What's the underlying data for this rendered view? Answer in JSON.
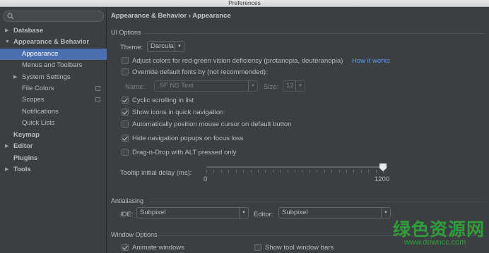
{
  "window": {
    "title": "Preferences"
  },
  "sidebar": {
    "search_placeholder": "",
    "items": [
      {
        "label": "Database",
        "arrow": "▶",
        "bold": true
      },
      {
        "label": "Appearance & Behavior",
        "arrow": "▼",
        "bold": true
      },
      {
        "label": "Appearance",
        "selected": true
      },
      {
        "label": "Menus and Toolbars"
      },
      {
        "label": "System Settings",
        "arrow": "▶"
      },
      {
        "label": "File Colors",
        "config_icon": true
      },
      {
        "label": "Scopes",
        "config_icon": true
      },
      {
        "label": "Notifications"
      },
      {
        "label": "Quick Lists"
      },
      {
        "label": "Keymap",
        "bold": true
      },
      {
        "label": "Editor",
        "arrow": "▶",
        "bold": true
      },
      {
        "label": "Plugins",
        "bold": true
      },
      {
        "label": "Tools",
        "arrow": "▶",
        "bold": true
      }
    ]
  },
  "breadcrumb": {
    "parent": "Appearance & Behavior",
    "separator": "›",
    "current": "Appearance"
  },
  "ui_options": {
    "section_title": "UI Options",
    "theme_label": "Theme:",
    "theme_value": "Darcula",
    "adjust_colors_label": "Adjust colors for red-green vision deficiency (protanopia, deuteranopia)",
    "adjust_colors_checked": false,
    "how_it_works_link": "How it works",
    "override_fonts_label": "Override default fonts by (not recommended):",
    "override_fonts_checked": false,
    "font_name_label": "Name:",
    "font_name_value": ".SF NS Text",
    "font_size_label": "Size:",
    "font_size_value": "12",
    "checkboxes": [
      {
        "label": "Cyclic scrolling in list",
        "checked": true
      },
      {
        "label": "Show icons in quick navigation",
        "checked": true
      },
      {
        "label": "Automatically position mouse cursor on default button",
        "checked": false
      },
      {
        "label": "Hide navigation popups on focus loss",
        "checked": true
      },
      {
        "label": "Drag-n-Drop with ALT pressed only",
        "checked": false
      }
    ],
    "tooltip_label": "Tooltip initial delay (ms):",
    "tooltip_min": "0",
    "tooltip_max": "1200",
    "tooltip_value": 1200
  },
  "antialiasing": {
    "section_title": "Antialiasing",
    "ide_label": "IDE:",
    "ide_value": "Subpixel",
    "editor_label": "Editor:",
    "editor_value": "Subpixel"
  },
  "window_options": {
    "section_title": "Window Options",
    "animate_windows_label": "Animate windows",
    "animate_windows_checked": true,
    "show_tool_window_bars_label": "Show tool window bars",
    "show_tool_window_bars_checked": false
  },
  "watermark": {
    "text_cn": "绿色资源网",
    "url": "www.downcc.com"
  },
  "colors": {
    "background": "#3c3f41",
    "selection": "#4b6eaf",
    "link": "#589df6",
    "watermark": "#2e9d3a"
  }
}
